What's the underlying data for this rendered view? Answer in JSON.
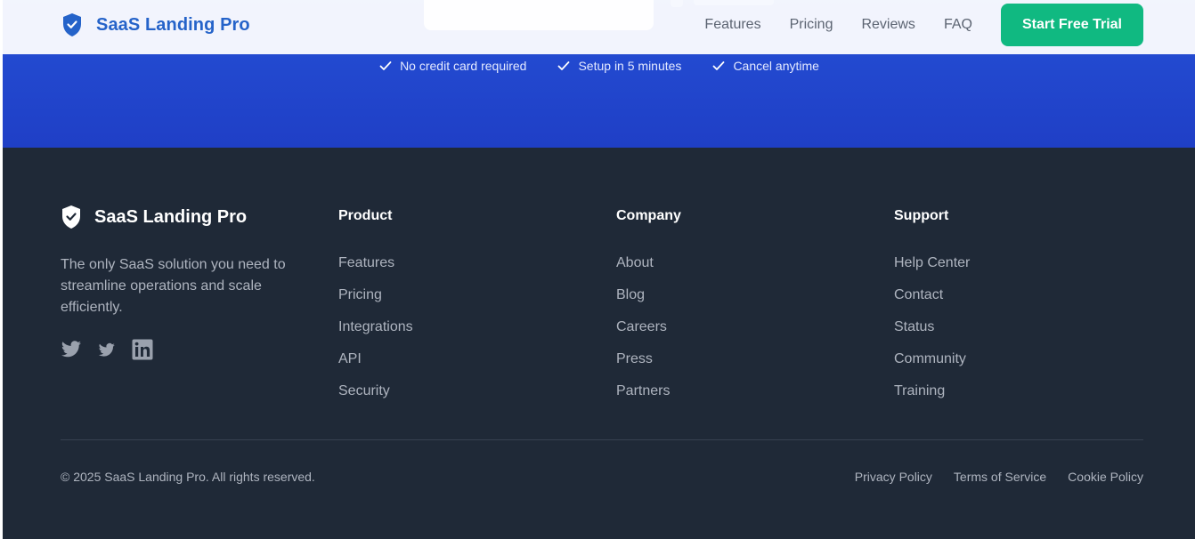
{
  "header": {
    "brand_name": "SaaS Landing Pro",
    "nav": [
      "Features",
      "Pricing",
      "Reviews",
      "FAQ"
    ],
    "cta_label": "Start Free Trial",
    "brand_color": "#2563c9",
    "cta_color": "#10b981"
  },
  "cta_band": {
    "checks": [
      "No credit card required",
      "Setup in 5 minutes",
      "Cancel anytime"
    ],
    "background_color": "#2550d6"
  },
  "footer": {
    "brand_name": "SaaS Landing Pro",
    "description": "The only SaaS solution you need to streamline operations and scale efficiently.",
    "socials": [
      "twitter-icon",
      "twitter-icon",
      "linkedin-icon"
    ],
    "columns": [
      {
        "title": "Product",
        "links": [
          "Features",
          "Pricing",
          "Integrations",
          "API",
          "Security"
        ]
      },
      {
        "title": "Company",
        "links": [
          "About",
          "Blog",
          "Careers",
          "Press",
          "Partners"
        ]
      },
      {
        "title": "Support",
        "links": [
          "Help Center",
          "Contact",
          "Status",
          "Community",
          "Training"
        ]
      }
    ],
    "copyright": "© 2025 SaaS Landing Pro. All rights reserved.",
    "legal": [
      "Privacy Policy",
      "Terms of Service",
      "Cookie Policy"
    ],
    "background_color": "#1f2937"
  }
}
